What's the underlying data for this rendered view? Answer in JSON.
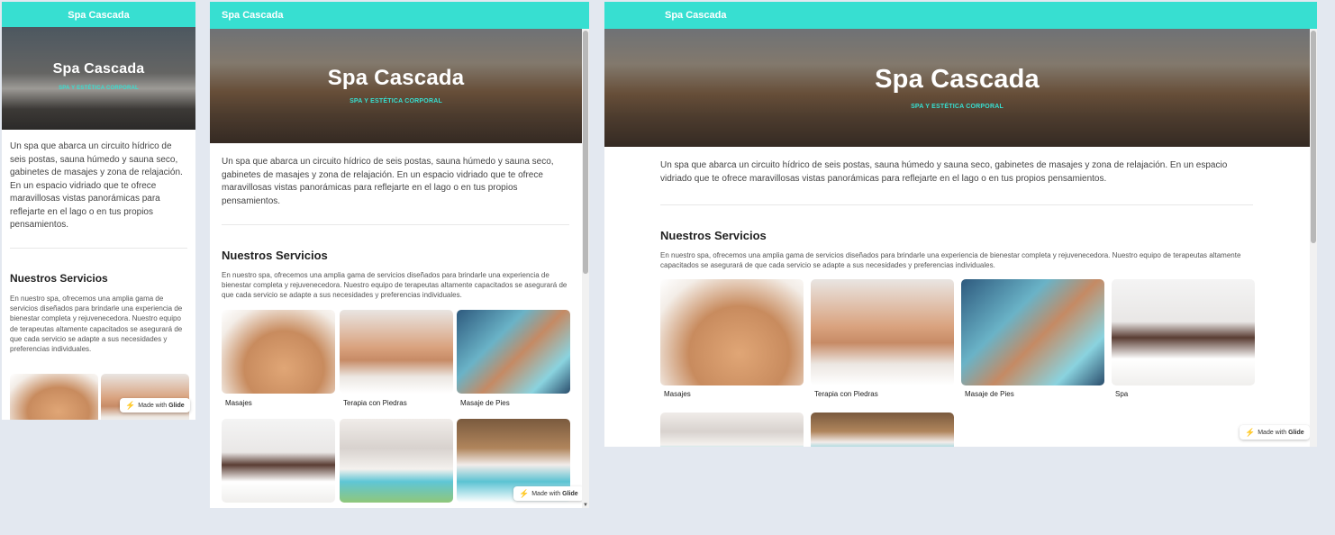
{
  "app": {
    "brand": "Spa Cascada",
    "title": "Spa Cascada",
    "subtitle": "SPA Y ESTÉTICA CORPORAL",
    "description": "Un spa que abarca un circuito hídrico de seis postas, sauna húmedo y sauna seco, gabinetes de masajes y zona de relajación. En un espacio vidriado que te ofrece maravillosas vistas panorámicas para reflejarte en el lago o en tus propios pensamientos.",
    "services_title": "Nuestros Servicios",
    "services_text": "En nuestro spa, ofrecemos una amplia gama de servicios diseñados para brindarle una experiencia de bienestar completa y rejuvenecedora. Nuestro equipo de terapeutas altamente capacitados se asegurará de que cada servicio se adapte a sus necesidades y preferencias individuales.",
    "badge_prefix": "Made with",
    "badge_brand": "Glide",
    "services": [
      {
        "label": "Masajes",
        "icon": "massage-photo"
      },
      {
        "label": "Terapia con Piedras",
        "icon": "stones-photo"
      },
      {
        "label": "Masaje de Pies",
        "icon": "feet-photo"
      },
      {
        "label": "Spa",
        "icon": "mask-photo"
      },
      {
        "label": "",
        "icon": "facial-photo"
      },
      {
        "label": "",
        "icon": "clay-photo"
      }
    ]
  },
  "colors": {
    "accent": "#37dfd1",
    "page_background": "#e3e8f0"
  }
}
